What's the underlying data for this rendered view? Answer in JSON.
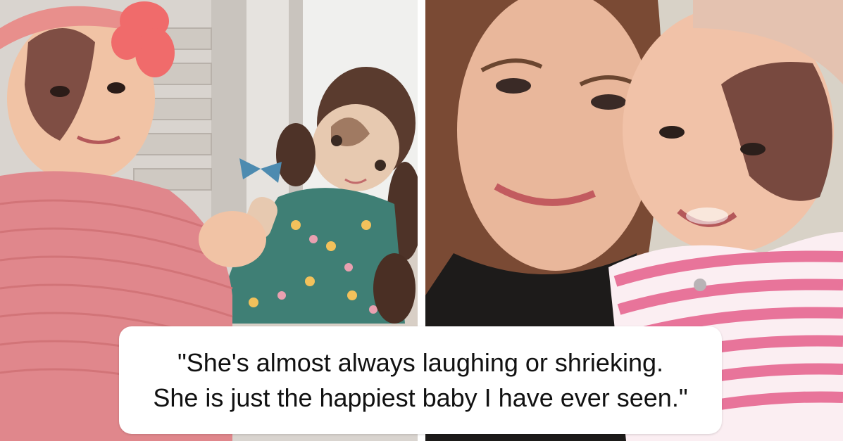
{
  "image": {
    "left_photo": {
      "subject": "baby-with-doll"
    },
    "right_photo": {
      "subject": "mother-and-baby-selfie"
    }
  },
  "caption": {
    "line1": "\"She's almost always laughing or shrieking.",
    "line2": "She is just the happiest baby I have ever seen.\""
  },
  "colors": {
    "caption_background": "#ffffff",
    "caption_text": "#111111",
    "sweater_pink": "#e0878c",
    "stripe_pink": "#e8749a"
  }
}
